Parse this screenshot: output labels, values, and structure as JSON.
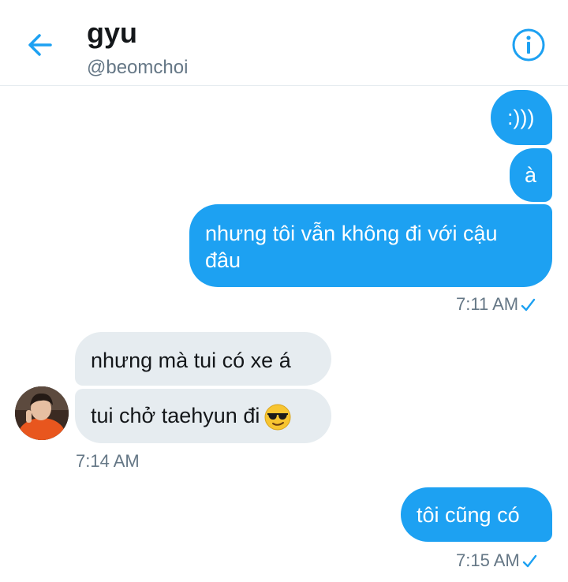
{
  "header": {
    "title": "gyu",
    "handle": "@beomchoi"
  },
  "messages": [
    {
      "text": ":)))",
      "direction": "sent"
    },
    {
      "text": "à",
      "direction": "sent"
    },
    {
      "text": "nhưng tôi vẫn không đi với cậu đâu",
      "direction": "sent",
      "lines": [
        "nhưng tôi vẫn không đi với cậu",
        "đâu"
      ]
    },
    {
      "text": "nhưng mà tui có xe á",
      "direction": "received"
    },
    {
      "text": "tui chở taehyun đi",
      "direction": "received",
      "emoji": "smiling-face-with-sunglasses"
    },
    {
      "text": "tôi cũng có",
      "direction": "sent"
    }
  ],
  "timestamps": {
    "sent_group_1": "7:11 AM",
    "received_group": "7:14 AM",
    "sent_group_2": "7:15 AM"
  },
  "colors": {
    "sent_bubble": "#1da1f2",
    "received_bubble": "#e6ecf0",
    "accent": "#1da1f2"
  }
}
